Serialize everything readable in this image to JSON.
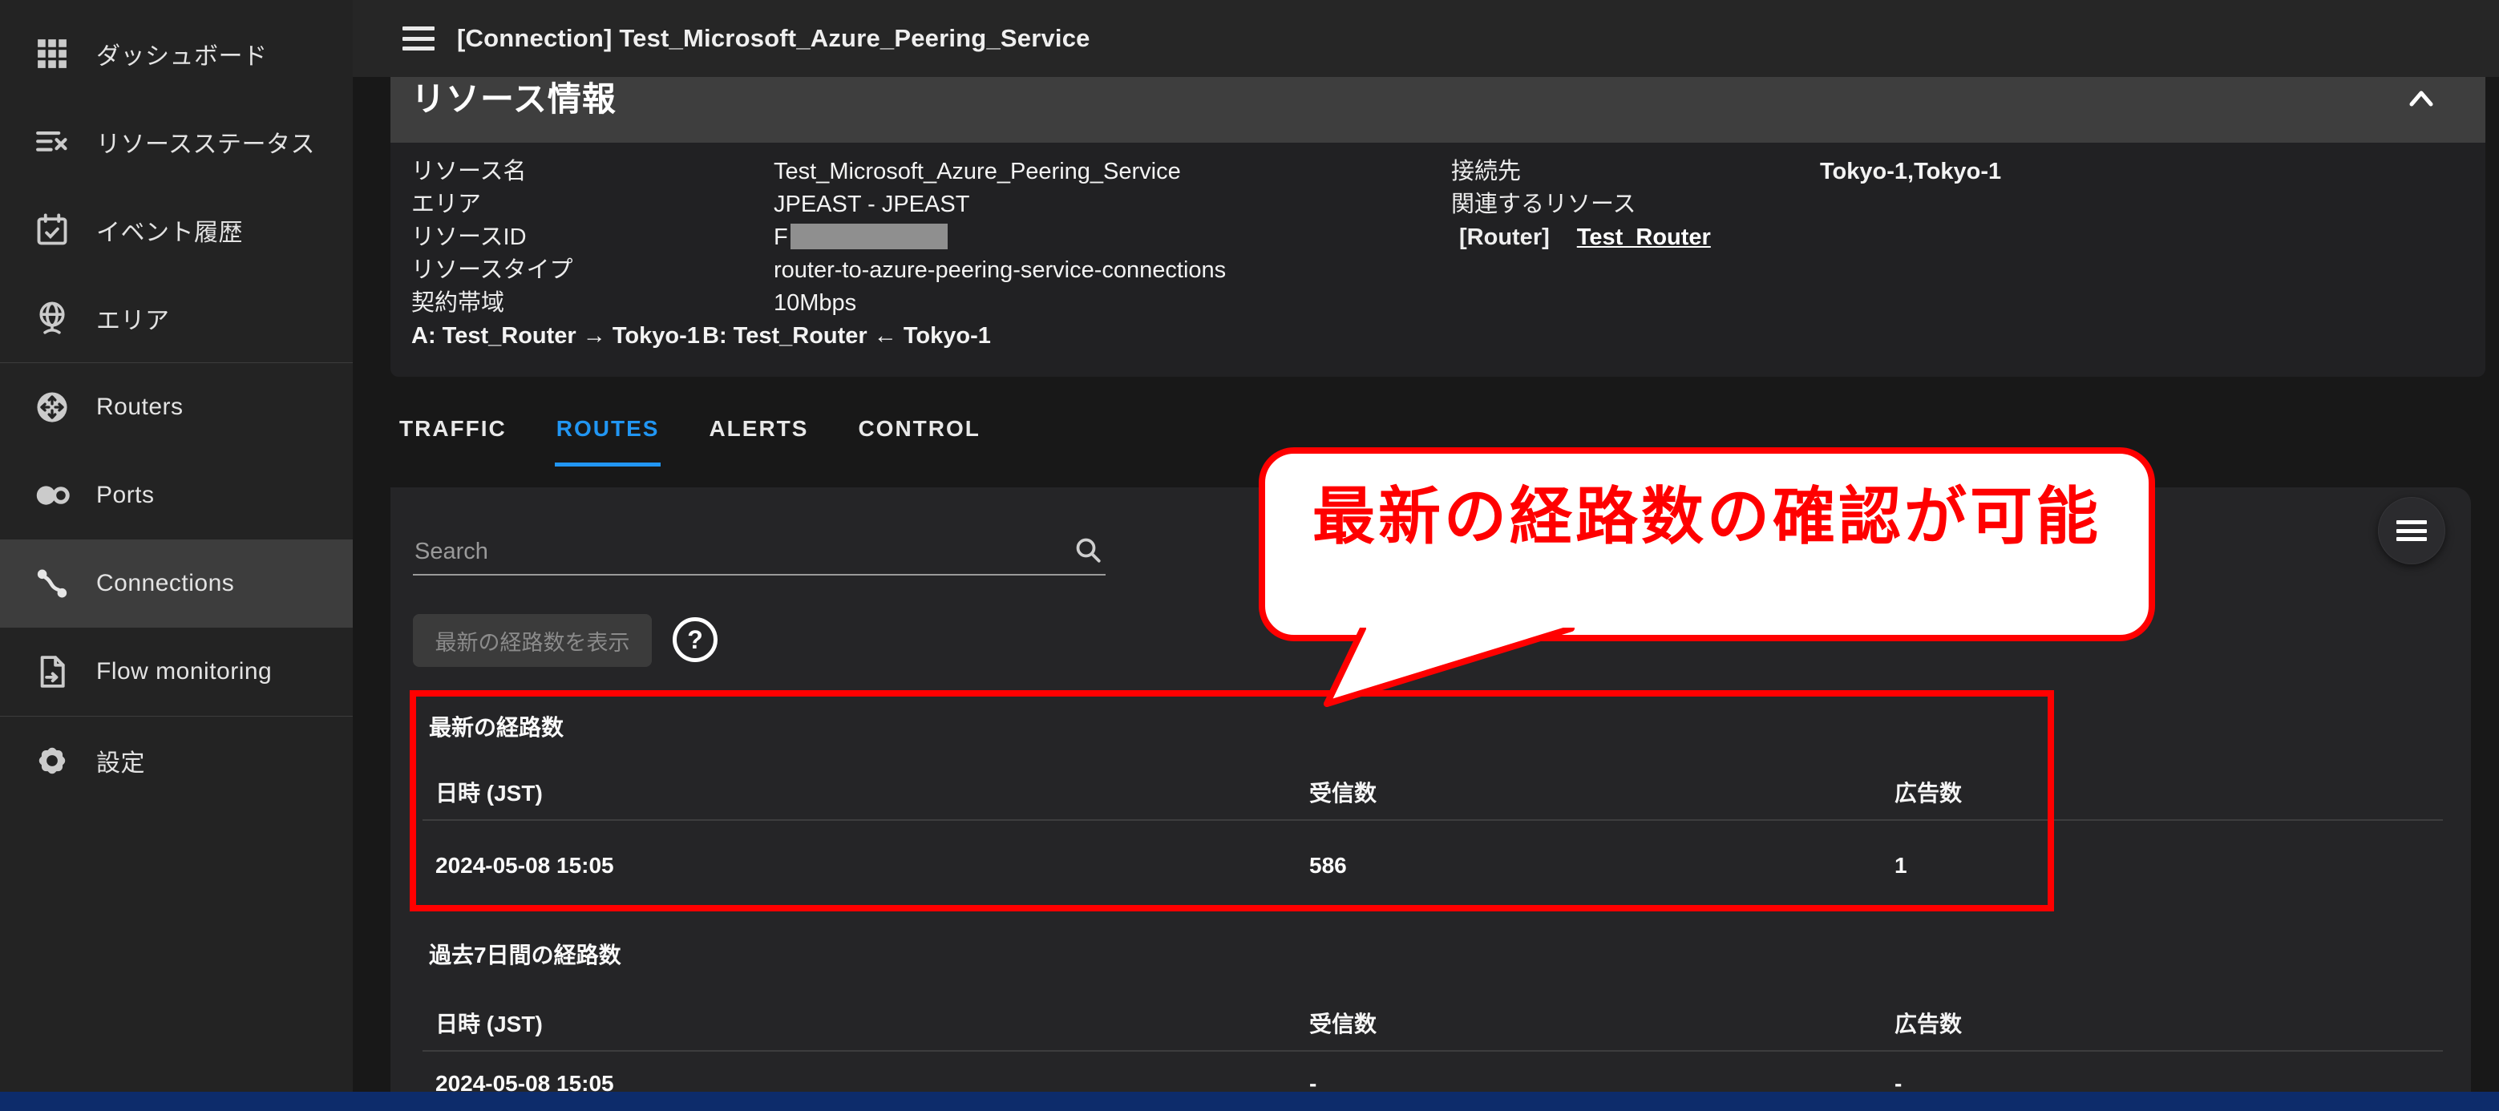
{
  "topbar": {
    "title": "[Connection] Test_Microsoft_Azure_Peering_Service"
  },
  "sidebar": {
    "items": [
      {
        "label": "ダッシュボード",
        "icon": "apps-grid-icon"
      },
      {
        "label": "リソースステータス",
        "icon": "resource-status-icon"
      },
      {
        "label": "イベント履歴",
        "icon": "event-history-icon"
      },
      {
        "label": "エリア",
        "icon": "area-globe-icon"
      },
      {
        "label": "Routers",
        "icon": "router-icon"
      },
      {
        "label": "Ports",
        "icon": "ports-icon"
      },
      {
        "label": "Connections",
        "icon": "connections-icon",
        "active": true
      },
      {
        "label": "Flow monitoring",
        "icon": "flow-monitoring-icon"
      },
      {
        "label": "設定",
        "icon": "settings-gear-icon"
      }
    ]
  },
  "resource_panel": {
    "title": "リソース情報",
    "fields_left": [
      {
        "label": "リソース名",
        "value": "Test_Microsoft_Azure_Peering_Service"
      },
      {
        "label": "エリア",
        "value": "JPEAST - JPEAST"
      },
      {
        "label": "リソースID",
        "value": "F",
        "redacted": true
      },
      {
        "label": "リソースタイプ",
        "value": "router-to-azure-peering-service-connections"
      },
      {
        "label": "契約帯域",
        "value": "10Mbps"
      }
    ],
    "endpoint_a": "A: Test_Router → Tokyo-1",
    "endpoint_b": "B: Test_Router ← Tokyo-1",
    "fields_right": {
      "connection_label": "接続先",
      "connection_value": "Tokyo-1,Tokyo-1",
      "related_label": "関連するリソース",
      "related_type": "[Router]",
      "related_link": "Test_Router"
    }
  },
  "tabs": [
    {
      "label": "TRAFFIC",
      "active": false
    },
    {
      "label": "ROUTES",
      "active": true
    },
    {
      "label": "ALERTS",
      "active": false
    },
    {
      "label": "CONTROL",
      "active": false
    }
  ],
  "routes_panel": {
    "search_placeholder": "Search",
    "show_latest_button": "最新の経路数を表示",
    "help_icon_text": "?",
    "latest_table": {
      "title": "最新の経路数",
      "columns": [
        "日時 (JST)",
        "受信数",
        "広告数"
      ],
      "rows": [
        [
          "2024-05-08 15:05",
          "586",
          "1"
        ]
      ]
    },
    "past7days_table": {
      "title": "過去7日間の経路数",
      "columns": [
        "日時 (JST)",
        "受信数",
        "広告数"
      ],
      "rows": [
        [
          "2024-05-08 15:05",
          "-",
          "-"
        ]
      ]
    }
  },
  "annotation": {
    "callout_text": "最新の経路数の確認が可能"
  },
  "colors": {
    "accent_blue": "#2196f3",
    "highlight_red": "#ff0000",
    "bottom_bar_blue": "#0d2c6b",
    "sidebar_bg": "#232323",
    "card_bg": "#252527",
    "panel_header_bg": "#3e3e3e"
  }
}
